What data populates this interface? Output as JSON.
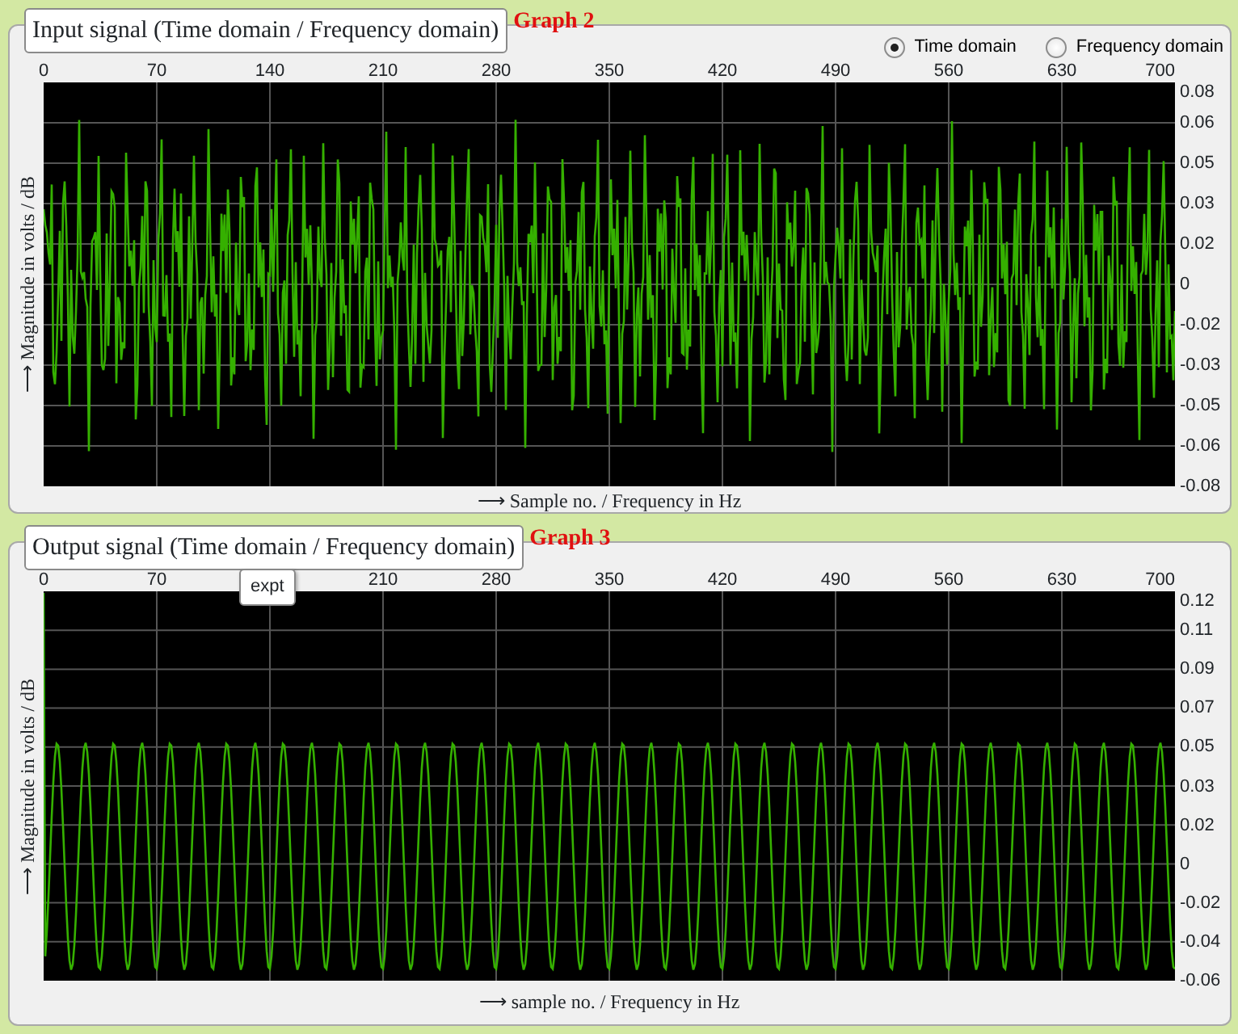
{
  "graphs": [
    {
      "title": "Input signal (Time domain / Frequency domain)",
      "label": "Graph 2",
      "domain_options": [
        {
          "label": "Time domain",
          "selected": true
        },
        {
          "label": "Frequency domain",
          "selected": false
        }
      ],
      "x_ticks": [
        "0",
        "70",
        "140",
        "210",
        "280",
        "350",
        "420",
        "490",
        "560",
        "630",
        "700"
      ],
      "y_ticks": [
        "0.08",
        "0.06",
        "0.05",
        "0.03",
        "0.02",
        "0",
        "-0.02",
        "-0.03",
        "-0.05",
        "-0.06",
        "-0.08"
      ],
      "y_axis_label": "⟶ Magnitude in volts / dB",
      "x_axis_label": "⟶ Sample no. / Frequency in Hz",
      "waveform": {
        "kind": "multitone"
      }
    },
    {
      "title": "Output signal (Time domain / Frequency domain)",
      "label": "Graph 3",
      "tooltip": "expt",
      "x_ticks": [
        "0",
        "70",
        "210",
        "280",
        "350",
        "420",
        "490",
        "560",
        "630",
        "700"
      ],
      "y_ticks": [
        "0.12",
        "0.11",
        "0.09",
        "0.07",
        "0.05",
        "0.03",
        "0.02",
        "0",
        "-0.02",
        "-0.04",
        "-0.06"
      ],
      "y_axis_label": "⟶ Magnitude in volts / dB",
      "x_axis_label": "⟶ sample no. / Frequency in Hz",
      "waveform": {
        "kind": "sine"
      }
    }
  ]
}
